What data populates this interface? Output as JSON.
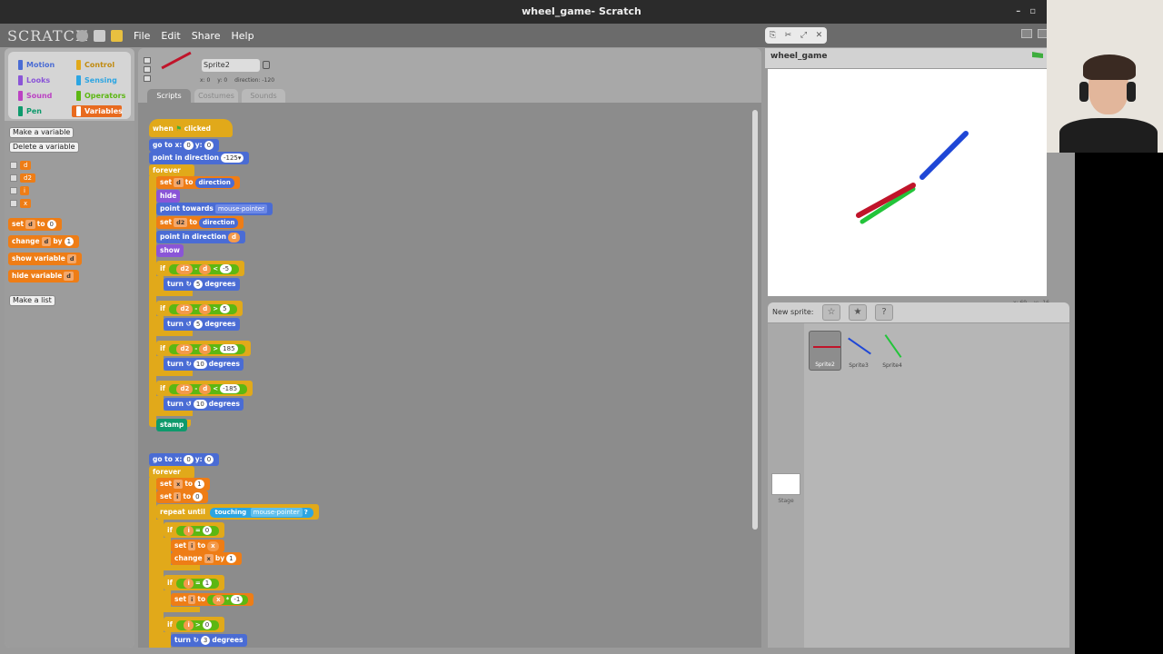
{
  "window": {
    "title": "wheel_game- Scratch",
    "minimize": "–",
    "restore": "▫"
  },
  "menubar": {
    "logo": "SCRATCH",
    "items": [
      "File",
      "Edit",
      "Share",
      "Help"
    ]
  },
  "categories": [
    {
      "label": "Motion",
      "color": "#4a6cd4"
    },
    {
      "label": "Control",
      "color": "#e1a91a"
    },
    {
      "label": "Looks",
      "color": "#8a55d7"
    },
    {
      "label": "Sensing",
      "color": "#2ca5e2"
    },
    {
      "label": "Sound",
      "color": "#bb42c3"
    },
    {
      "label": "Operators",
      "color": "#5cb712"
    },
    {
      "label": "Pen",
      "color": "#0e9a6c"
    },
    {
      "label": "Variables",
      "color": "#ee7d16"
    }
  ],
  "palette": {
    "make_variable": "Make a variable",
    "delete_variable": "Delete a variable",
    "variables": [
      "d",
      "d2",
      "i",
      "x"
    ],
    "set_block": {
      "label": "set",
      "var": "d",
      "to": "to",
      "value": "0"
    },
    "change_block": {
      "label": "change",
      "var": "d",
      "by": "by",
      "value": "1"
    },
    "show_block": {
      "label": "show variable",
      "var": "d"
    },
    "hide_block": {
      "label": "hide variable",
      "var": "d"
    },
    "make_list": "Make a list"
  },
  "sprite": {
    "name": "Sprite2",
    "x": "x: 0",
    "y": "y: 0",
    "direction": "direction: -120",
    "tabs": [
      "Scripts",
      "Costumes",
      "Sounds"
    ]
  },
  "script1": {
    "hat_when": "when",
    "hat_clicked": "clicked",
    "goto_label": "go to x:",
    "goto_x": "0",
    "goto_ylabel": "y:",
    "goto_y": "0",
    "point_dir_label": "point in direction",
    "point_dir_val": "-125▾",
    "forever": "forever",
    "set1": {
      "set": "set",
      "var": "d",
      "to": "to",
      "val": "direction"
    },
    "hide": "hide",
    "point_towards": "point towards",
    "point_towards_val": "mouse-pointer",
    "set2": {
      "set": "set",
      "var": "d2",
      "to": "to",
      "val": "direction"
    },
    "point_dir2": "point in direction",
    "point_dir2_val": "d",
    "show": "show",
    "if": "if",
    "ifs": [
      {
        "a": "d2",
        "minus": "-",
        "b": "d",
        "op": "<",
        "num": "-5",
        "turn": "turn ↻",
        "deg": "5",
        "degrees": "degrees"
      },
      {
        "a": "d2",
        "minus": "-",
        "b": "d",
        "op": ">",
        "num": "5",
        "turn": "turn ↺",
        "deg": "5",
        "degrees": "degrees"
      },
      {
        "a": "d2",
        "minus": "-",
        "b": "d",
        "op": ">",
        "num": "185",
        "turn": "turn ↻",
        "deg": "10",
        "degrees": "degrees"
      },
      {
        "a": "d2",
        "minus": "-",
        "b": "d",
        "op": "<",
        "num": "-185",
        "turn": "turn ↺",
        "deg": "10",
        "degrees": "degrees"
      }
    ],
    "stamp": "stamp"
  },
  "script2": {
    "goto_label": "go to x:",
    "goto_x": "0",
    "goto_ylabel": "y:",
    "goto_y": "0",
    "forever": "forever",
    "set_x": {
      "set": "set",
      "var": "x",
      "to": "to",
      "val": "1"
    },
    "set_i": {
      "set": "set",
      "var": "i",
      "to": "to",
      "val": "0"
    },
    "repeat_until": "repeat until",
    "touching": "touching",
    "touching_val": "mouse-pointer",
    "q": "?",
    "if": "if",
    "if1": {
      "a": "i",
      "op": "=",
      "b": "0"
    },
    "set_i_x": {
      "set": "set",
      "var": "i",
      "to": "to",
      "val": "x"
    },
    "change_x": {
      "label": "change",
      "var": "x",
      "by": "by",
      "val": "1"
    },
    "if2": {
      "a": "i",
      "op": "=",
      "b": "1"
    },
    "set_i_neg": {
      "set": "set",
      "var": "i",
      "to": "to",
      "a": "x",
      "op": "*",
      "b": "-1"
    },
    "if3": {
      "a": "i",
      "op": ">",
      "b": "0"
    },
    "turn_last": {
      "turn": "turn ↻",
      "deg": "3",
      "degrees": "degrees"
    }
  },
  "stage": {
    "project_name": "wheel_game",
    "x_readout": "x: 69",
    "y_readout": "y: -16"
  },
  "sprites_panel": {
    "new_sprite": "New sprite:",
    "buttons": [
      "☆",
      "★",
      "?"
    ],
    "sprites": [
      {
        "name": "Sprite2",
        "color": "#c0142a"
      },
      {
        "name": "Sprite3",
        "color": "#1f47d6"
      },
      {
        "name": "Sprite4",
        "color": "#23c43a"
      }
    ],
    "stage_label": "Stage"
  }
}
